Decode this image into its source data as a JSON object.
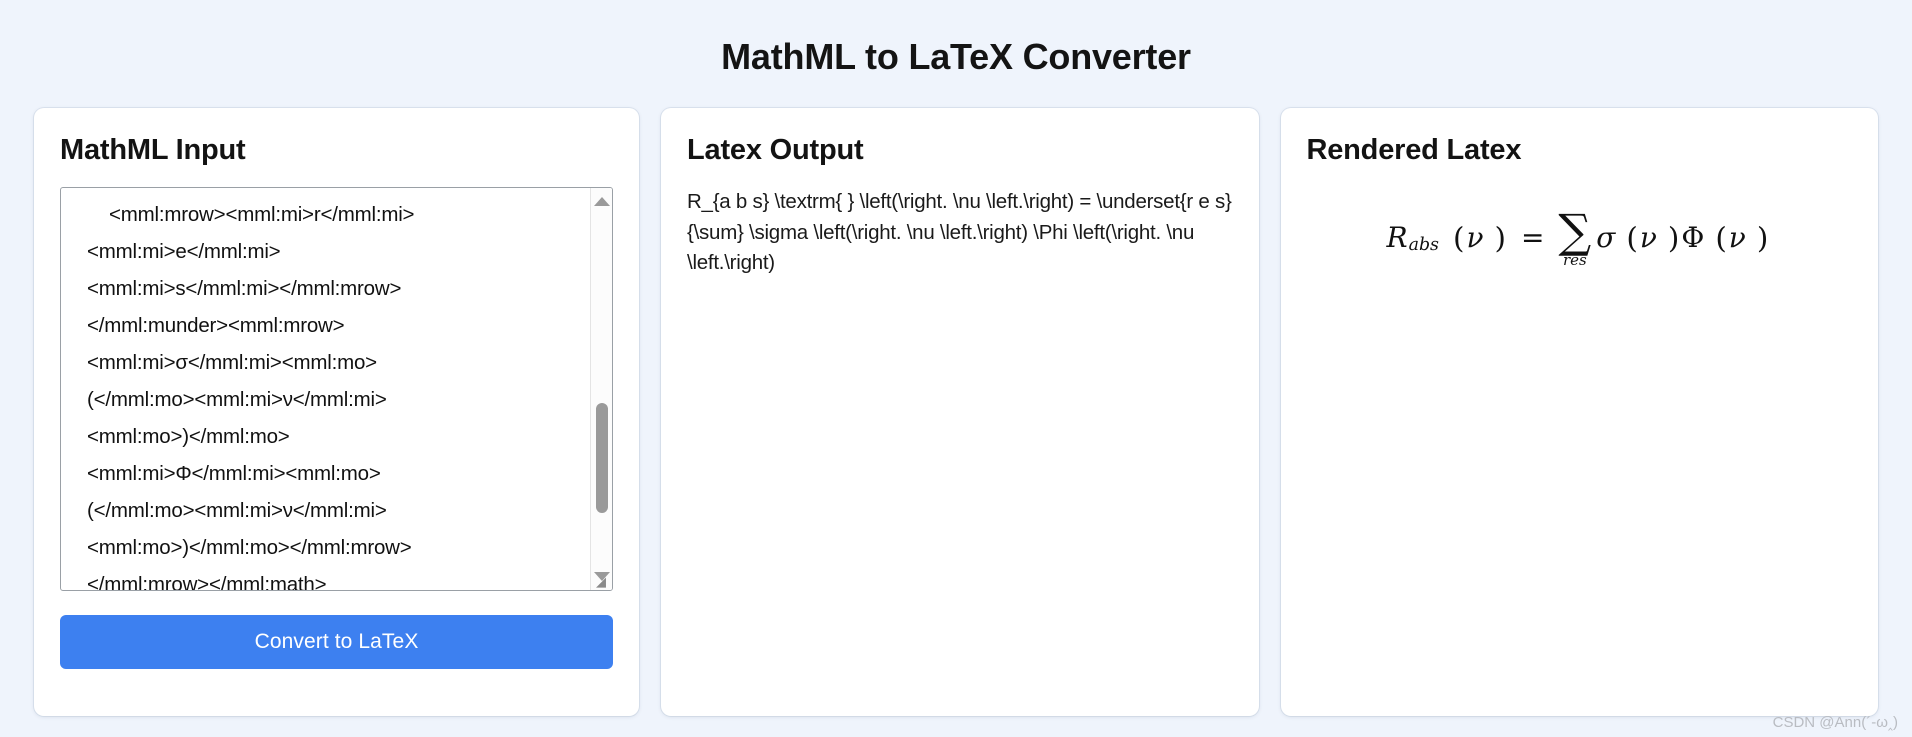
{
  "app": {
    "title": "MathML to LaTeX Converter",
    "background_color": "#eff4fc",
    "accent_color": "#3d80f0"
  },
  "input_panel": {
    "title": "MathML Input",
    "textarea_name": "mathml-input",
    "value": "    <mml:mrow><mml:mi>r</mml:mi>\n<mml:mi>e</mml:mi>\n<mml:mi>s</mml:mi></mml:mrow>\n</mml:munder><mml:mrow>\n<mml:mi>σ</mml:mi><mml:mo>\n(</mml:mo><mml:mi>ν</mml:mi>\n<mml:mo>)</mml:mo>\n<mml:mi>Φ</mml:mi><mml:mo>\n(</mml:mo><mml:mi>ν</mml:mi>\n<mml:mo>)</mml:mo></mml:mrow>\n</mml:mrow></mml:math>",
    "placeholder": "",
    "convert_button_label": "Convert to LaTeX",
    "scrollbar": {
      "up_arrow": "scroll-up-arrow",
      "down_arrow": "scroll-down-arrow",
      "thumb_position": "near-bottom"
    },
    "resize_grip_glyph": "◢"
  },
  "output_panel": {
    "title": "Latex Output",
    "latex": "R_{a b s} \\textrm{ } \\left(\\right. \\nu \\left.\\right) = \\underset{r e s}{\\sum} \\sigma \\left(\\right. \\nu \\left.\\right) \\Phi \\left(\\right. \\nu \\left.\\right)"
  },
  "render_panel": {
    "title": "Rendered Latex",
    "formula": {
      "base_symbol": "R",
      "base_subscript": "abs",
      "open_paren_1": "(",
      "variable_1": "ν",
      "close_paren_1": ")",
      "equals": "=",
      "sum_symbol": "∑",
      "sum_under": "res",
      "sigma": "σ",
      "open_paren_2": "(",
      "variable_2": "ν",
      "close_paren_2": ")",
      "phi": "Φ",
      "open_paren_3": "(",
      "variable_3": "ν",
      "close_paren_3": ")"
    }
  },
  "watermark": {
    "text": "CSDN @Ann(´-ω‸)"
  }
}
